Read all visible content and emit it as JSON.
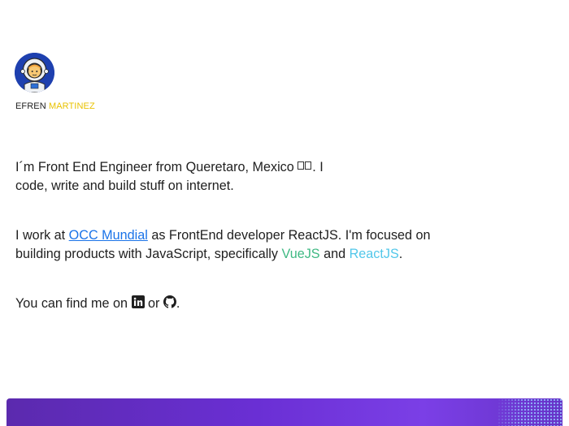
{
  "profile": {
    "first_name": "EFREN",
    "last_name": "MARTINEZ",
    "avatar_icon": "astronaut-icon"
  },
  "intro": {
    "text_before_flag": "I´m Front End Engineer from Queretaro, Mexico",
    "flag_icon": "mexico-flag-icon",
    "text_after_flag": ". I code, write and build stuff on internet."
  },
  "work": {
    "text_1": "I work at ",
    "company_link": "OCC Mundial",
    "text_2": " as FrontEnd developer ReactJS. I'm focused on building products with JavaScript, specifically ",
    "vue_link": "VueJS",
    "text_3": " and ",
    "react_link": "ReactJS",
    "text_4": "."
  },
  "social": {
    "text_1": "You can find me on ",
    "linkedin_icon": "linkedin-icon",
    "text_2": " or ",
    "github_icon": "github-icon",
    "text_3": "."
  },
  "colors": {
    "last_name": "#e9c200",
    "occ_link": "#1a73e8",
    "vue": "#3fb983",
    "react": "#52c7ea",
    "footer": "#6a2fd4"
  }
}
